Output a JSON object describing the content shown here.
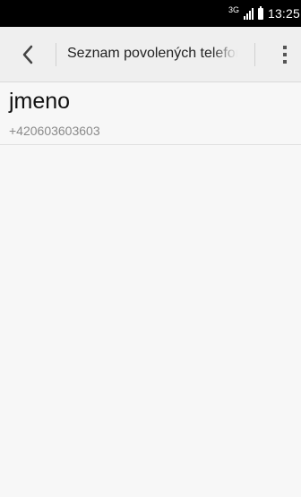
{
  "status_bar": {
    "network": "3G",
    "time": "13:25"
  },
  "action_bar": {
    "title": "Seznam povolených telefonních čísel"
  },
  "contacts": [
    {
      "name": "jmeno",
      "number": "+420603603603"
    }
  ],
  "icons": {
    "back": "chevron-left-icon",
    "overflow": "more-vertical-icon",
    "signal": "signal-icon",
    "battery": "battery-icon"
  },
  "colors": {
    "status_bar_bg": "#000000",
    "action_bar_bg": "#efefef",
    "background": "#f7f7f7"
  }
}
